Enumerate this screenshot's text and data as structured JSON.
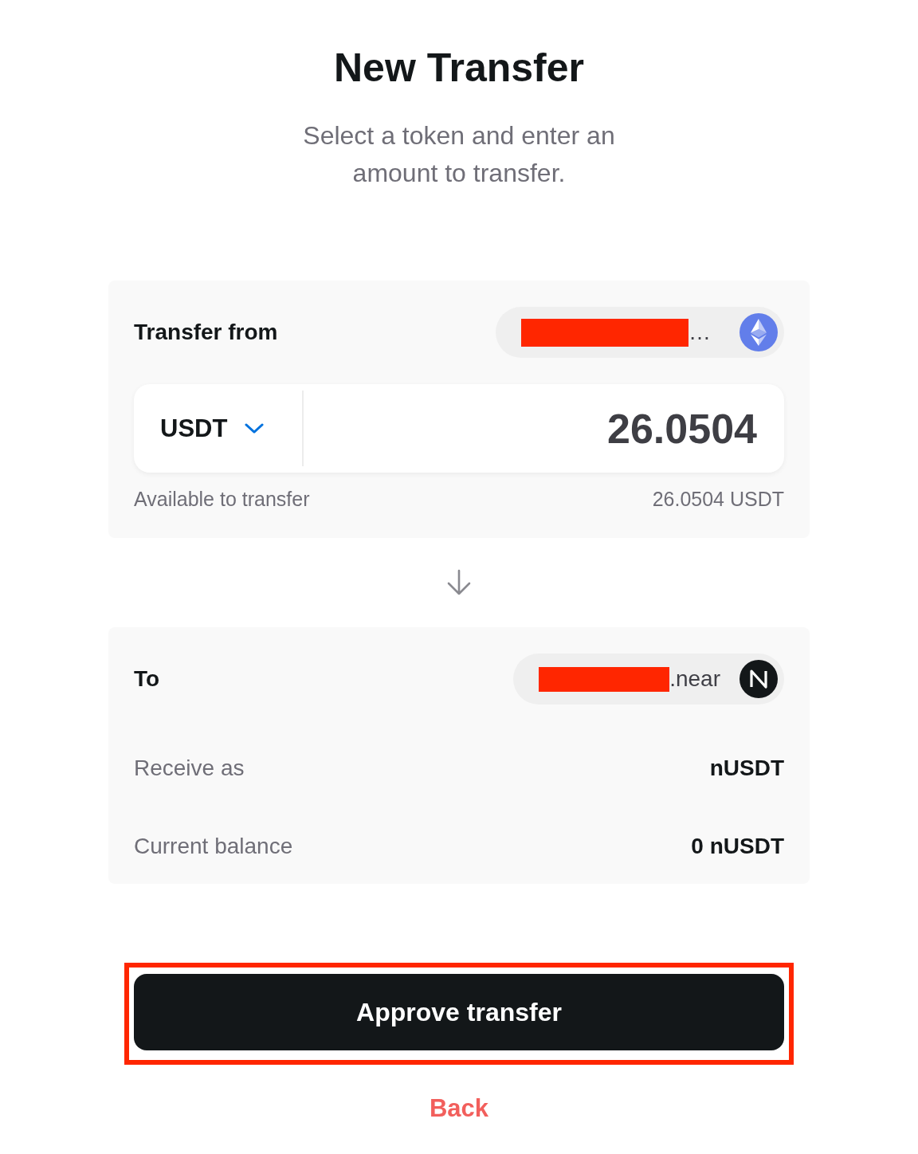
{
  "title": "New Transfer",
  "subtitle": "Select a token and enter an amount to transfer.",
  "source": {
    "label": "Transfer from",
    "account": {
      "kind": "ethereum",
      "redacted": true,
      "text": "…"
    },
    "token": "USDT",
    "amount": "26.0504",
    "available_label": "Available to transfer",
    "available_value": "26.0504 USDT"
  },
  "destination": {
    "label": "To",
    "account": {
      "kind": "near",
      "redacted": true,
      "text": ".near"
    },
    "details": [
      {
        "label": "Receive as",
        "value": "nUSDT"
      },
      {
        "label": "Current balance",
        "value": "0 nUSDT"
      }
    ]
  },
  "approve_button": {
    "label": "Approve transfer",
    "highlighted": true
  },
  "back_link": "Back"
}
